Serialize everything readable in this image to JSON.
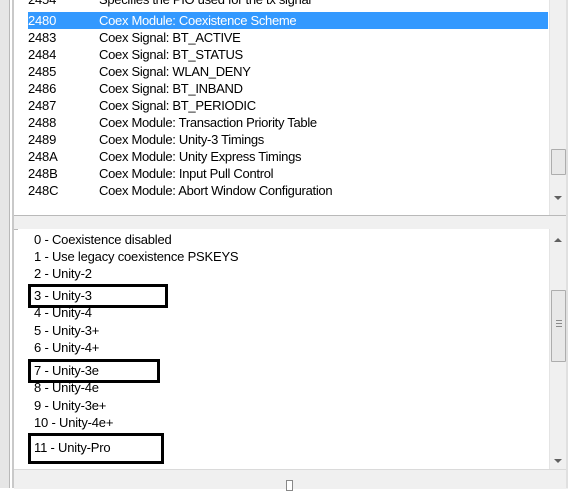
{
  "top_list": {
    "clipped_row": {
      "code": "2454",
      "desc": "Specifies the PIO used for the tx signal"
    },
    "rows": [
      {
        "code": "2480",
        "desc": "Coex Module: Coexistence Scheme",
        "selected": true
      },
      {
        "code": "2483",
        "desc": "Coex Signal: BT_ACTIVE"
      },
      {
        "code": "2484",
        "desc": "Coex Signal: BT_STATUS"
      },
      {
        "code": "2485",
        "desc": "Coex Signal: WLAN_DENY"
      },
      {
        "code": "2486",
        "desc": "Coex Signal:  BT_INBAND"
      },
      {
        "code": "2487",
        "desc": "Coex Signal:  BT_PERIODIC"
      },
      {
        "code": "2488",
        "desc": "Coex Module:  Transaction Priority Table"
      },
      {
        "code": "2489",
        "desc": "Coex Module:  Unity-3 Timings"
      },
      {
        "code": "248A",
        "desc": "Coex Module:  Unity Express Timings"
      },
      {
        "code": "248B",
        "desc": "Coex Module: Input Pull Control"
      },
      {
        "code": "248C",
        "desc": "Coex Module: Abort Window Configuration"
      }
    ]
  },
  "options": [
    "0 - Coexistence disabled",
    "1 - Use legacy coexistence PSKEYS",
    "2 - Unity-2",
    "3 - Unity-3",
    "4 - Unity-4",
    "5 - Unity-3+",
    "6 - Unity-4+",
    "7 - Unity-3e",
    "8 - Unity-4e",
    "9 - Unity-3e+",
    "10 - Unity-4e+",
    "11 - Unity-Pro"
  ],
  "highlighted_options": [
    "3 - Unity-3",
    "7 - Unity-3e",
    "11 - Unity-Pro"
  ],
  "icons": [
    "scroll-up-arrow-icon",
    "scroll-down-arrow-icon",
    "scroll-grip-icon"
  ],
  "colors": {
    "selection": "#3399ff",
    "highlight_box": "#000000"
  }
}
